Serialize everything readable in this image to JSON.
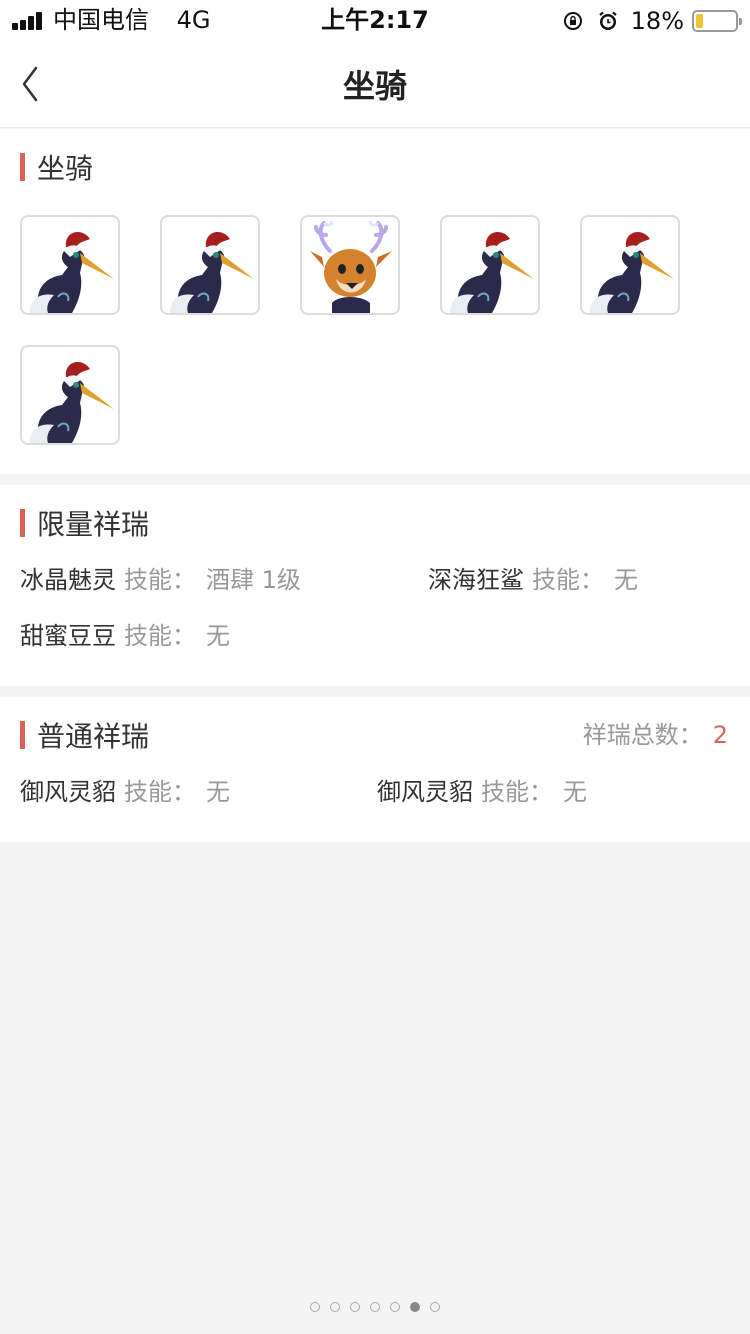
{
  "status_bar": {
    "carrier": "中国电信",
    "network": "4G",
    "time": "上午2:17",
    "battery_percent_label": "18%",
    "battery_level": 0.18
  },
  "nav": {
    "title": "坐骑"
  },
  "mounts_section": {
    "title": "坐骑",
    "items": [
      {
        "icon": "crane-mount-icon"
      },
      {
        "icon": "crane-mount-icon"
      },
      {
        "icon": "deer-mount-icon"
      },
      {
        "icon": "crane-mount-icon"
      },
      {
        "icon": "crane-mount-icon"
      },
      {
        "icon": "crane-mount-icon"
      }
    ]
  },
  "limited_section": {
    "title": "限量祥瑞",
    "skill_label": "技能：",
    "pets": [
      {
        "name": "冰晶魅灵",
        "skill": "酒肆 1级"
      },
      {
        "name": "深海狂鲨",
        "skill": "无"
      },
      {
        "name": "甜蜜豆豆",
        "skill": "无"
      }
    ]
  },
  "normal_section": {
    "title": "普通祥瑞",
    "total_label": "祥瑞总数：",
    "total_value": "2",
    "skill_label": "技能：",
    "pets": [
      {
        "name": "御风灵貂",
        "skill": "无"
      },
      {
        "name": "御风灵貂",
        "skill": "无"
      }
    ]
  },
  "pager": {
    "count": 7,
    "active_index": 5
  },
  "colors": {
    "accent": "#d9635a",
    "background": "#f4f4f4"
  }
}
